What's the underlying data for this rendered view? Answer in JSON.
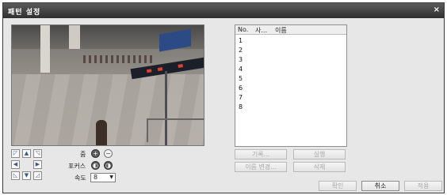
{
  "window": {
    "title": "패턴 설정",
    "close_glyph": "×"
  },
  "ptz": {
    "up_left": "◸",
    "up": "▲",
    "up_right": "◹",
    "left": "◀",
    "right": "▶",
    "down_left": "◺",
    "down": "▼",
    "down_right": "◿"
  },
  "controls": {
    "zoom_label": "줌",
    "zoom_in": "+",
    "zoom_out": "−",
    "focus_label": "포커스",
    "focus_near": "◐",
    "focus_far": "◑",
    "speed_label": "속도",
    "speed_value": "8"
  },
  "list": {
    "col_no": "No.",
    "col_use": "사...",
    "col_name": "이름",
    "rows": [
      "1",
      "2",
      "3",
      "4",
      "5",
      "6",
      "7",
      "8"
    ]
  },
  "buttons": {
    "record": "기록...",
    "run": "실행",
    "rename": "이름 변경...",
    "delete": "삭제",
    "ok": "확인",
    "cancel": "취소",
    "apply": "적용"
  }
}
